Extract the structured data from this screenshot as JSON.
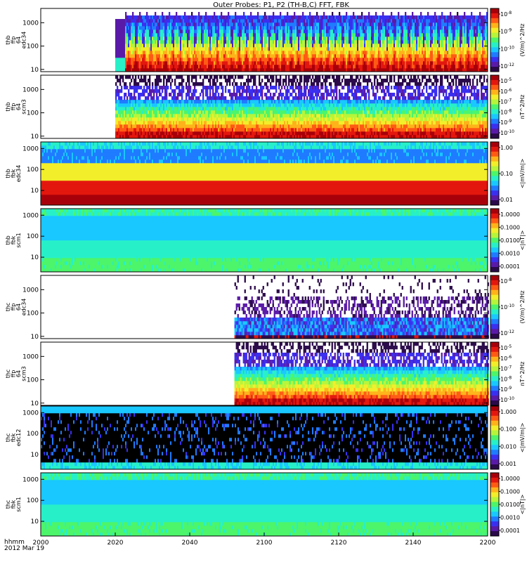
{
  "title": "Outer Probes: P1, P2 (TH-B,C) FFT, FBK",
  "footer": {
    "time_label": "hhmm",
    "date_label": "2012 Mar 19"
  },
  "colors": {
    "colormap": [
      "#2b0a4a",
      "#5a1aa8",
      "#3a2ff0",
      "#1f7bff",
      "#19c8ff",
      "#27f0c8",
      "#4cf56a",
      "#b6f53a",
      "#f2ee2a",
      "#ffb21a",
      "#ff5a14",
      "#e3170e",
      "#a8000a"
    ],
    "background": "#ffffff",
    "axis": "#000000"
  },
  "chart_data": {
    "type": "heatmap",
    "x_axis": {
      "ticks": [
        "2000",
        "2020",
        "2040",
        "2100",
        "2120",
        "2140",
        "2200"
      ],
      "range": [
        "2000",
        "2200"
      ],
      "unit": "hhmm"
    },
    "panels": [
      {
        "id": "thb-ffp-edc34",
        "ylabel_lines": [
          "thb",
          "ffp",
          "64",
          "edc34"
        ],
        "y_ticks": [
          "1000",
          "100",
          "10"
        ],
        "y_range": [
          8,
          4096
        ],
        "data_start": "2020",
        "pattern": "periodic",
        "cbar_ticks": [
          "10^-8",
          "10^-9",
          "10^-10",
          "10^-12"
        ],
        "cbar_label": "(V/m)^2/Hz"
      },
      {
        "id": "thb-ffp-scm3",
        "ylabel_lines": [
          "thb",
          "ffp",
          "64",
          "scm3"
        ],
        "y_ticks": [
          "1000",
          "100",
          "10"
        ],
        "y_range": [
          8,
          4096
        ],
        "data_start": "2020",
        "pattern": "layered",
        "cbar_ticks": [
          "10^-5",
          "10^-6",
          "10^-7",
          "10^-8",
          "10^-9",
          "10^-10"
        ],
        "cbar_label": "nT^2/Hz"
      },
      {
        "id": "thb-fbk-edc34",
        "ylabel_lines": [
          "thb",
          "fbk",
          "edc34"
        ],
        "y_ticks": [
          "1000",
          "100",
          "10"
        ],
        "y_range": [
          2,
          2048
        ],
        "data_start": "2000",
        "pattern": "bands_hot",
        "cbar_ticks": [
          "1.00",
          "0.10",
          "0.01"
        ],
        "cbar_label": "<|mV/m|>"
      },
      {
        "id": "thb-fbk-scm1",
        "ylabel_lines": [
          "thb",
          "fbk",
          "scm1"
        ],
        "y_ticks": [
          "1000",
          "100",
          "10"
        ],
        "y_range": [
          2,
          2048
        ],
        "data_start": "2000",
        "pattern": "bands_cool",
        "cbar_ticks": [
          "1.0000",
          "0.1000",
          "0.0100",
          "0.0010",
          "0.0001"
        ],
        "cbar_label": "<|nT|>"
      },
      {
        "id": "thc-ffp-edc34",
        "ylabel_lines": [
          "thc",
          "ffp",
          "64",
          "edc34"
        ],
        "y_ticks": [
          "1000",
          "100",
          "10"
        ],
        "y_range": [
          8,
          4096
        ],
        "data_start": "2052",
        "pattern": "sparse",
        "cbar_ticks": [
          "10^-8",
          "10^-10",
          "10^-12"
        ],
        "cbar_label": "(V/m)^2/Hz"
      },
      {
        "id": "thc-ffp-scm3",
        "ylabel_lines": [
          "thc",
          "ffp",
          "64",
          "scm3"
        ],
        "y_ticks": [
          "1000",
          "100",
          "10"
        ],
        "y_range": [
          8,
          4096
        ],
        "data_start": "2052",
        "pattern": "layered",
        "cbar_ticks": [
          "10^-5",
          "10^-6",
          "10^-7",
          "10^-8",
          "10^-9",
          "10^-10"
        ],
        "cbar_label": "nT^2/Hz"
      },
      {
        "id": "thc-fbk-edc12",
        "ylabel_lines": [
          "thc",
          "fbk",
          "edc12"
        ],
        "y_ticks": [
          "1000",
          "100",
          "10"
        ],
        "y_range": [
          2,
          2048
        ],
        "data_start": "2000",
        "pattern": "dark",
        "cbar_ticks": [
          "1.000",
          "0.100",
          "0.010",
          "0.001"
        ],
        "cbar_label": "<|mV/m|>"
      },
      {
        "id": "thc-fbk-scm1",
        "ylabel_lines": [
          "thc",
          "fbk",
          "scm1"
        ],
        "y_ticks": [
          "1000",
          "100",
          "10"
        ],
        "y_range": [
          2,
          2048
        ],
        "data_start": "2000",
        "pattern": "bands_cool",
        "cbar_ticks": [
          "1.0000",
          "0.1000",
          "0.0100",
          "0.0010",
          "0.0001"
        ],
        "cbar_label": "<|nT|>"
      }
    ]
  }
}
